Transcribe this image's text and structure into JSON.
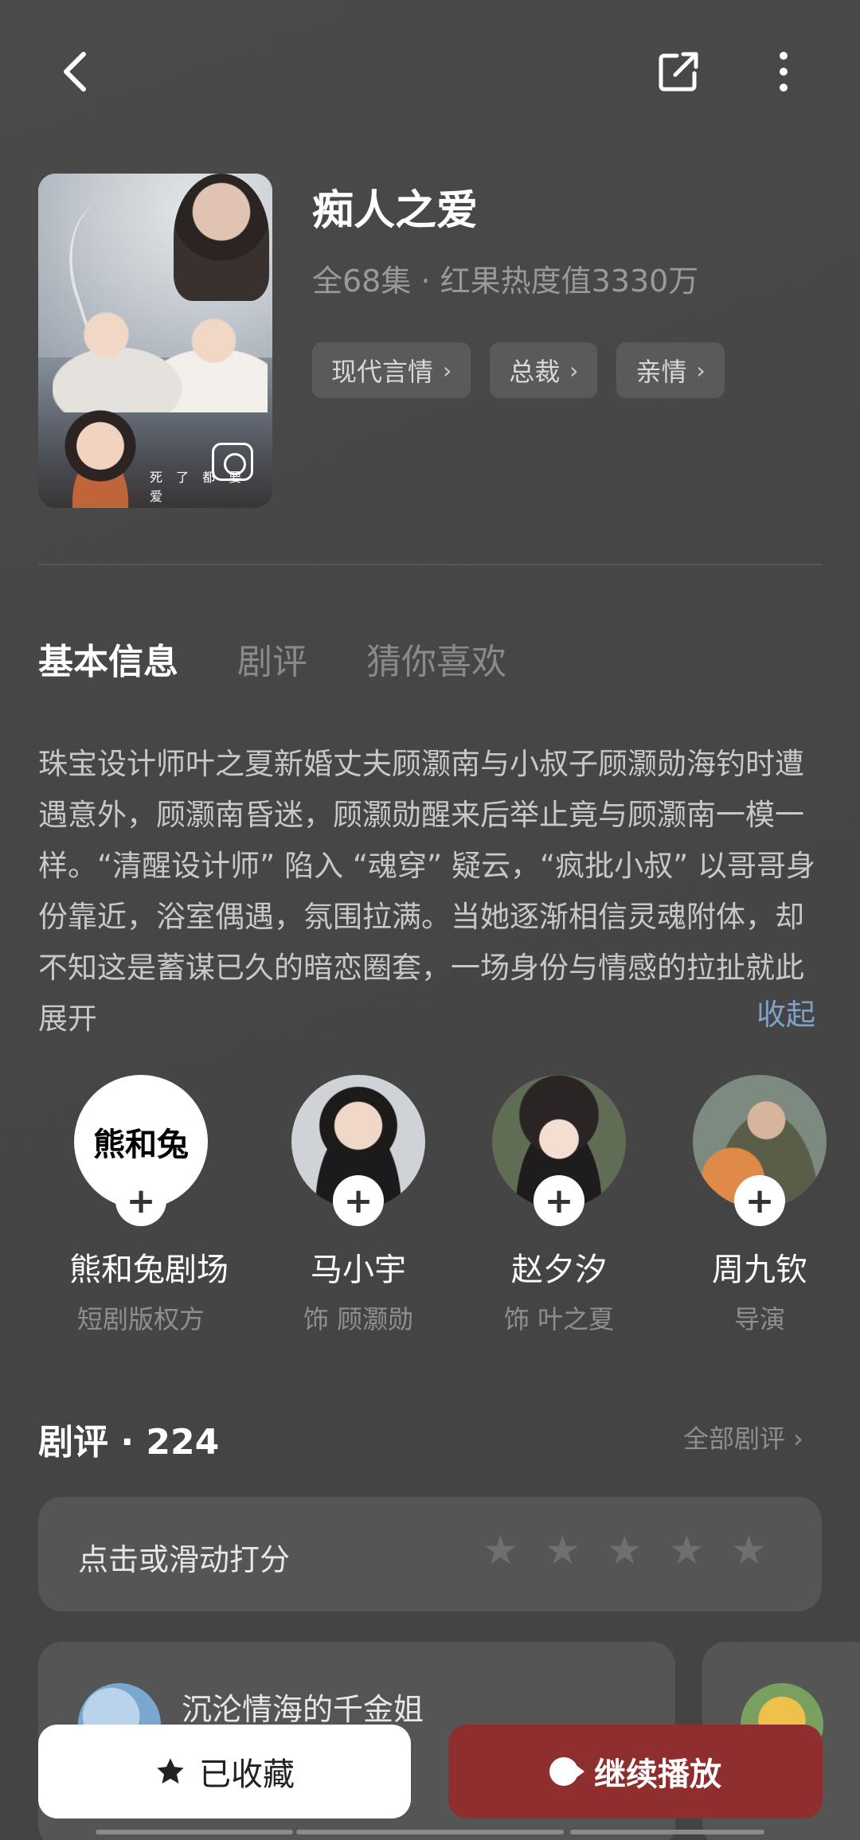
{
  "header": {
    "back_icon": "chevron-left-icon",
    "share_icon": "share-icon",
    "more_icon": "more-vertical-icon"
  },
  "drama": {
    "title": "痴人之爱",
    "meta": "全68集 · 红果热度值3330万",
    "poster_subtitle": "死 了 都 要 爱",
    "tags": [
      {
        "label": "现代言情"
      },
      {
        "label": "总裁"
      },
      {
        "label": "亲情"
      }
    ]
  },
  "tabs": [
    {
      "label": "基本信息"
    },
    {
      "label": "剧评"
    },
    {
      "label": "猜你喜欢"
    }
  ],
  "description": "珠宝设计师叶之夏新婚丈夫顾灏南与小叔子顾灏勋海钓时遭遇意外，顾灏南昏迷，顾灏勋醒来后举止竟与顾灏南一模一样。“清醒设计师” 陷入 “魂穿” 疑云，“疯批小叔” 以哥哥身份靠近，浴室偶遇，氛围拉满。当她逐渐相信灵魂附体，却不知这是蓄谋已久的暗恋圈套，一场身份与情感的拉扯就此展开",
  "collapse_label": "收起",
  "people": [
    {
      "name": "熊和兔剧场",
      "role": "短剧版权方",
      "logo": "熊和兔"
    },
    {
      "name": "马小宇",
      "role": "饰 顾灏勋"
    },
    {
      "name": "赵夕汐",
      "role": "饰 叶之夏"
    },
    {
      "name": "周九钦",
      "role": "导演"
    }
  ],
  "reviews": {
    "title": "剧评 · 224",
    "all_label": "全部剧评 ›",
    "rate_prompt": "点击或滑动打分",
    "stars": 5,
    "first_reviewer": "沉沦情海的千金姐"
  },
  "bottom": {
    "favorite_label": "已收藏",
    "play_label": "继续播放"
  }
}
